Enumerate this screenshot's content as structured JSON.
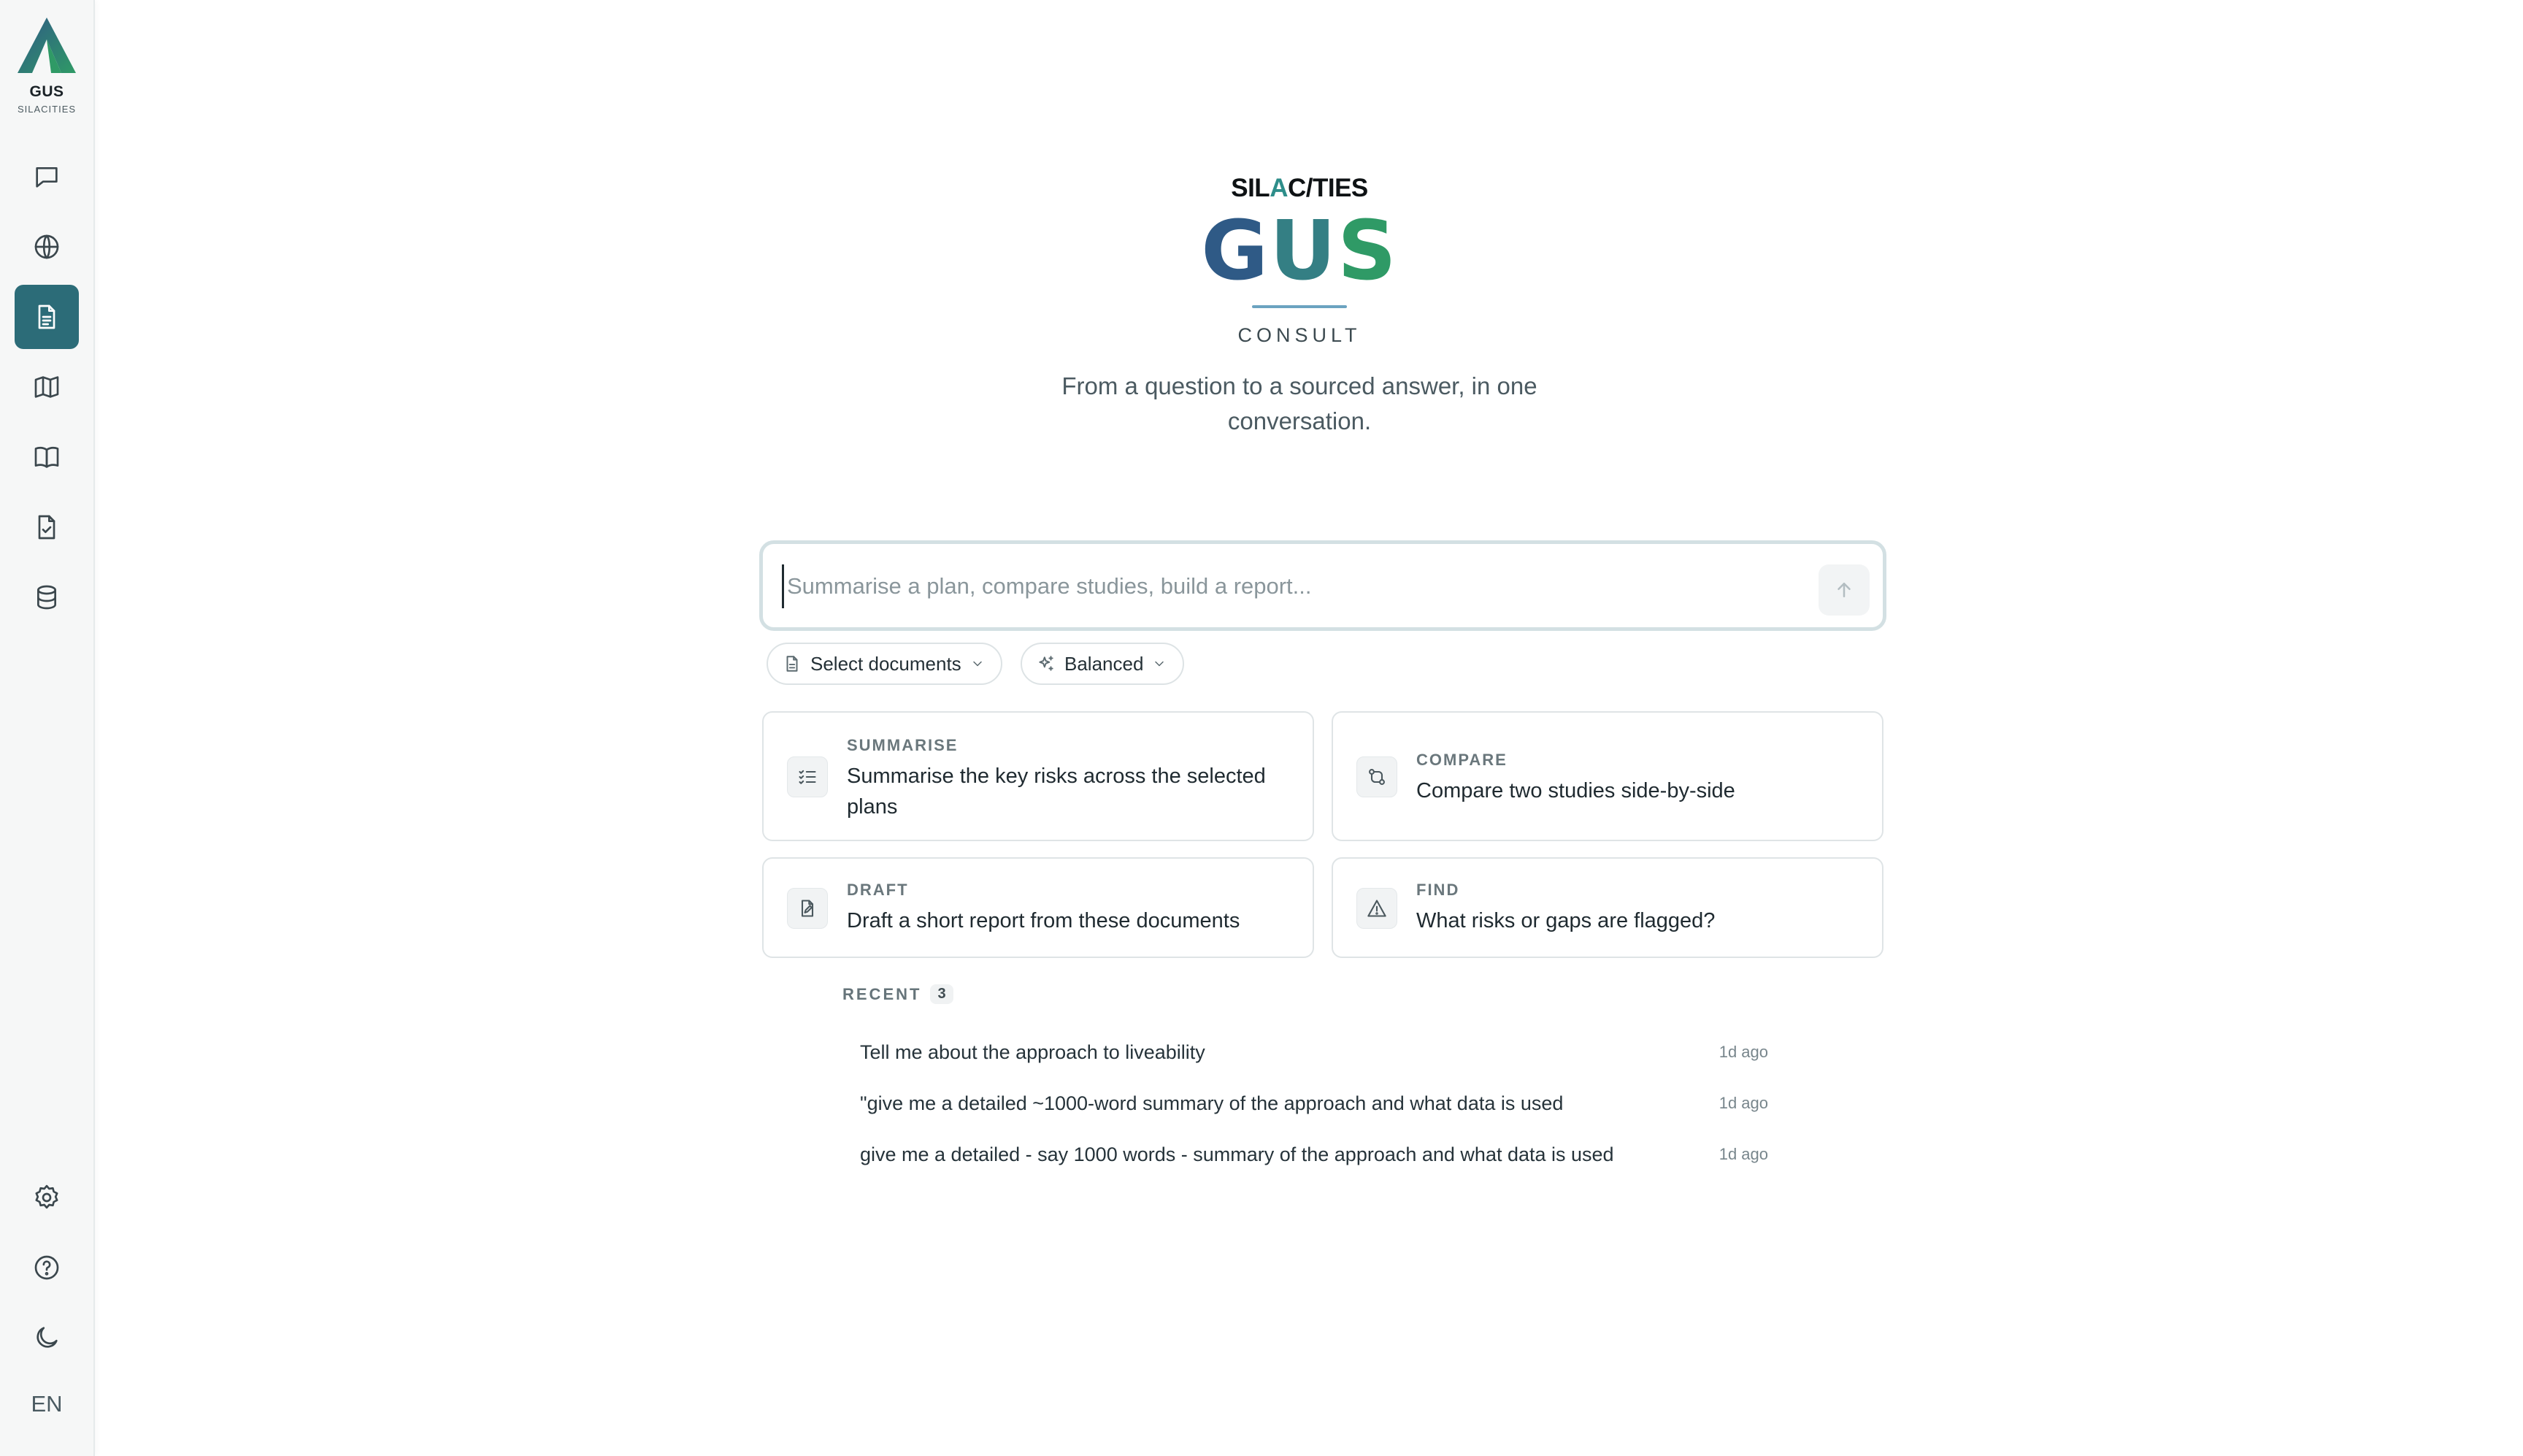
{
  "brand": {
    "name": "GUS",
    "sub": "SILACITIES"
  },
  "nav": {
    "items": [
      {
        "icon": "chat-icon"
      },
      {
        "icon": "globe-icon"
      },
      {
        "icon": "document-icon",
        "active": true
      },
      {
        "icon": "map-icon"
      },
      {
        "icon": "book-icon"
      },
      {
        "icon": "file-check-icon"
      },
      {
        "icon": "database-icon"
      }
    ],
    "bottom": [
      {
        "icon": "settings-icon"
      },
      {
        "icon": "help-icon"
      },
      {
        "icon": "moon-icon"
      }
    ],
    "language": "EN"
  },
  "hero": {
    "logo_sub_a": "SIL",
    "logo_sub_slash": "A",
    "logo_sub_b": "C/TIES",
    "logo_g": "G",
    "logo_u": "U",
    "logo_s": "S",
    "product": "CONSULT",
    "tagline": "From a question to a sourced answer, in one conversation."
  },
  "composer": {
    "placeholder": "Summarise a plan, compare studies, build a report...",
    "value": "",
    "send_icon": "arrow-up-icon"
  },
  "controls": {
    "documents_label": "Select documents",
    "mode_label": "Balanced"
  },
  "suggestions": [
    {
      "kicker": "SUMMARISE",
      "text": "Summarise the key risks across the selected plans",
      "icon": "list-check-icon"
    },
    {
      "kicker": "COMPARE",
      "text": "Compare two studies side-by-side",
      "icon": "compare-icon"
    },
    {
      "kicker": "DRAFT",
      "text": "Draft a short report from these documents",
      "icon": "draft-icon"
    },
    {
      "kicker": "FIND",
      "text": "What risks or gaps are flagged?",
      "icon": "warning-icon"
    }
  ],
  "recent": {
    "label": "RECENT",
    "count": "3",
    "items": [
      {
        "title": "Tell me about the approach to liveability",
        "time": "1d ago"
      },
      {
        "title": "\"give me a detailed ~1000-word summary of the approach and what data is used",
        "time": "1d ago"
      },
      {
        "title": "give me a detailed - say 1000 words - summary of the approach and what data is used",
        "time": "1d ago"
      }
    ]
  },
  "colors": {
    "accent": "#2c6c78",
    "logo_blue": "#2f5a86",
    "logo_teal": "#347f84",
    "logo_green": "#2f9a66"
  }
}
